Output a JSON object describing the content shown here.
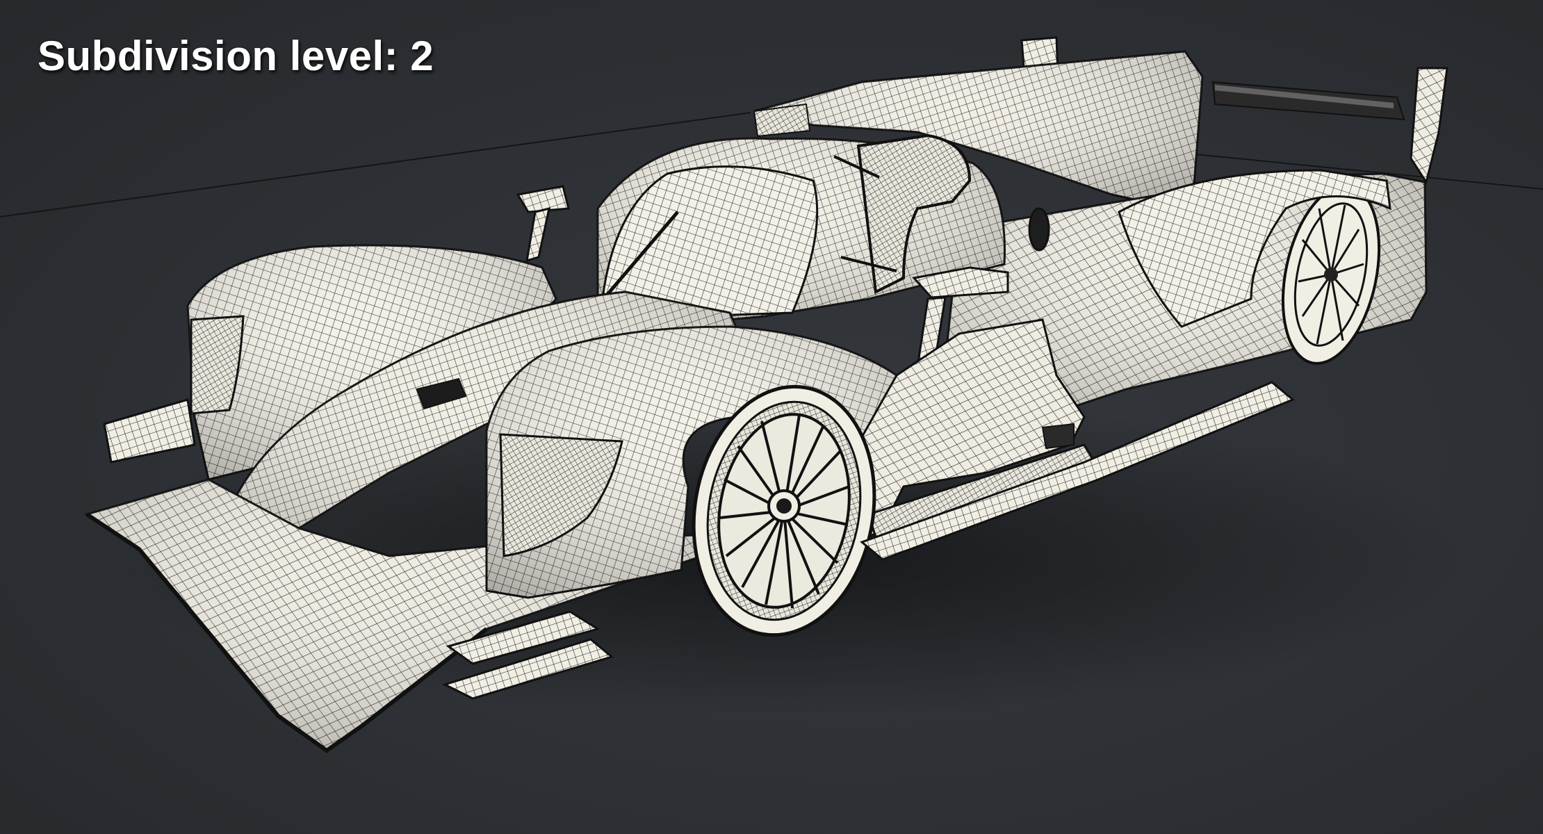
{
  "caption": {
    "label": "Subdivision level: 2"
  },
  "render": {
    "subject": "wireframe-lmp-race-car",
    "background_color": "#2d3034",
    "surface_color": "#f2efe6",
    "wire_color": "#1b1b1b"
  }
}
